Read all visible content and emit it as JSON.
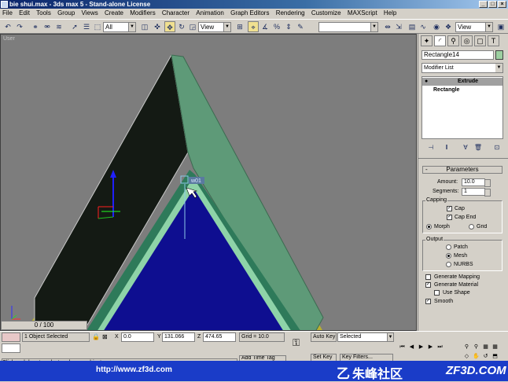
{
  "window": {
    "title": "bie shui.max - 3ds max 5 - Stand-alone License",
    "min": "_",
    "max": "□",
    "close": "×"
  },
  "menu": [
    "File",
    "Edit",
    "Tools",
    "Group",
    "Views",
    "Create",
    "Modifiers",
    "Character",
    "Animation",
    "Graph Editors",
    "Rendering",
    "Customize",
    "MAXScript",
    "Help"
  ],
  "toolbar": {
    "selection_filter": "All",
    "ref_coord": "View",
    "named_sel": "",
    "view_right": "View"
  },
  "viewport": {
    "label": "User",
    "gizmo_label": "w01"
  },
  "command_panel": {
    "object_name": "Rectangle14",
    "object_color": "#9ccfa0",
    "modifier_list": "Modifier List",
    "stack": [
      {
        "label": "Extrude",
        "selected": true
      },
      {
        "label": "Rectangle",
        "selected": false
      }
    ],
    "parameters": {
      "title": "Parameters",
      "amount_label": "Amount:",
      "amount": "10.0",
      "segments_label": "Segments:",
      "segments": "1",
      "capping_label": "Capping",
      "cap_start": "Cap",
      "cap_end": "Cap End",
      "morph": "Morph",
      "grid": "Grid",
      "output_label": "Output",
      "patch": "Patch",
      "mesh": "Mesh",
      "nurbs": "NURBS",
      "gen_mapping": "Generate Mapping",
      "gen_material": "Generate Material",
      "use_shape": "Use Shape",
      "smooth": "Smooth"
    }
  },
  "status": {
    "selected": "1 Object Selected",
    "prompt": "Click and drag to select and move objects",
    "x_label": "X",
    "x": "0.0",
    "y_label": "Y",
    "y": "131.066",
    "z_label": "Z",
    "z": "474.65",
    "grid": "Grid = 10.0",
    "auto_key": "Auto Key",
    "set_key": "Set Key",
    "key_mode": "Selected",
    "key_filters": "Key Filters...",
    "add_time_tag": "Add Time Tag",
    "time_slider": "0 / 100"
  },
  "footer": {
    "url": "http://www.zf3d.com",
    "logo_cn": "朱峰社区",
    "logo_en": "ZF3D.COM"
  }
}
